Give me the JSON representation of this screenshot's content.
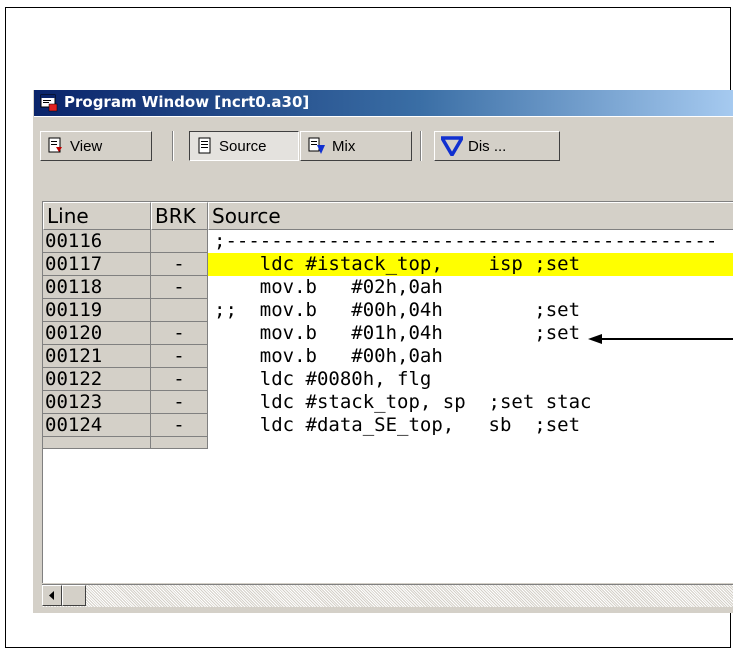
{
  "window": {
    "title": "Program Window [ncrt0.a30]",
    "icon": "program-window-icon"
  },
  "toolbar": {
    "view_label": "View",
    "source_label": "Source",
    "mix_label": "Mix",
    "dis_label": "Dis ...",
    "source_pressed": true
  },
  "columns": {
    "line": "Line",
    "brk": "BRK",
    "source": "Source"
  },
  "rows": [
    {
      "line": "00116",
      "brk": "",
      "source": ";-------------------------------------------",
      "highlight": false
    },
    {
      "line": "00117",
      "brk": "-",
      "source": "    ldc #istack_top,    isp ;set",
      "highlight": true
    },
    {
      "line": "00118",
      "brk": "-",
      "source": "    mov.b   #02h,0ah",
      "highlight": false
    },
    {
      "line": "00119",
      "brk": "",
      "source": ";;  mov.b   #00h,04h        ;set",
      "highlight": false
    },
    {
      "line": "00120",
      "brk": "-",
      "source": "    mov.b   #01h,04h        ;set",
      "highlight": false
    },
    {
      "line": "00121",
      "brk": "-",
      "source": "    mov.b   #00h,0ah",
      "highlight": false
    },
    {
      "line": "00122",
      "brk": "-",
      "source": "    ldc #0080h, flg",
      "highlight": false
    },
    {
      "line": "00123",
      "brk": "-",
      "source": "    ldc #stack_top, sp  ;set stac",
      "highlight": false
    },
    {
      "line": "00124",
      "brk": "-",
      "source": "    ldc #data_SE_top,   sb  ;set",
      "highlight": false
    }
  ],
  "colors": {
    "highlight": "#ffff00",
    "title_start": "#0a246a",
    "title_end": "#a6caf0"
  },
  "annotation": {
    "arrow": "pointer-arrow-to-line-00118"
  }
}
